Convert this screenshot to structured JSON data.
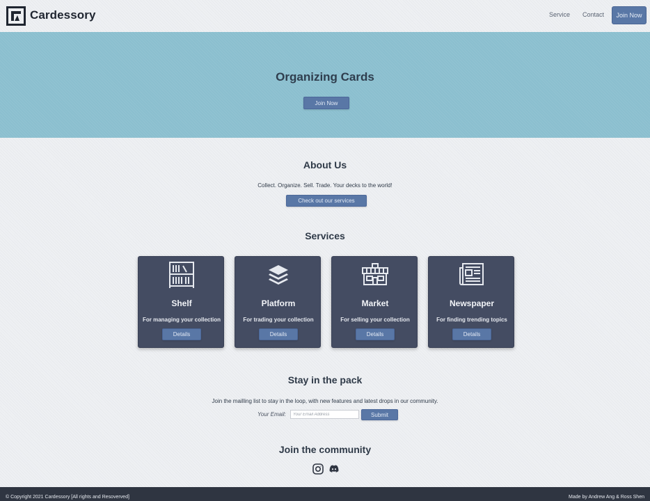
{
  "brand": {
    "name": "Cardessory"
  },
  "nav": {
    "service": "Service",
    "contact": "Contact",
    "join": "Join Now"
  },
  "hero": {
    "title": "Organizing Cards",
    "button": "Join Now"
  },
  "about": {
    "title": "About Us",
    "text": "Collect. Organize. Sell. Trade. Your decks to the world!",
    "button": "Check out our services"
  },
  "services": {
    "title": "Services",
    "cards": [
      {
        "icon": "bookshelf-icon",
        "title": "Shelf",
        "subtitle": "For managing your collection",
        "button": "Details"
      },
      {
        "icon": "layers-icon",
        "title": "Platform",
        "subtitle": "For trading your collection",
        "button": "Details"
      },
      {
        "icon": "storefront-icon",
        "title": "Market",
        "subtitle": "For selling your collection",
        "button": "Details"
      },
      {
        "icon": "newspaper-icon",
        "title": "Newspaper",
        "subtitle": "For finding trending topics",
        "button": "Details"
      }
    ]
  },
  "pack": {
    "title": "Stay in the pack",
    "text": "Join the mailling list to stay in the loop, with new features and latest drops in our community.",
    "email_label": "Your Email:",
    "email_placeholder": "Your Email Address",
    "email_value": "",
    "submit": "Submit"
  },
  "community": {
    "title": "Join the community",
    "icons": [
      "instagram-icon",
      "discord-icon"
    ]
  },
  "footer": {
    "left": "© Copyright 2021 Cardessory [All rights and Resoverved]",
    "right": "Made by Andrew Ang & Ross Shen"
  },
  "colors": {
    "accent": "#5977a6",
    "hero_bg": "#8bbfcf",
    "card_bg": "#444c62",
    "footer_bg": "#2f3541"
  }
}
